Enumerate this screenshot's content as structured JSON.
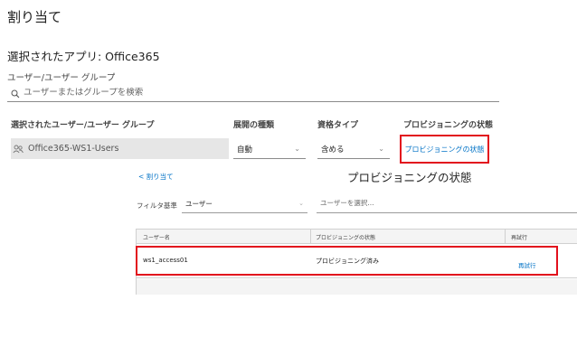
{
  "page": {
    "title": "割り当て"
  },
  "app": {
    "label": "選択されたアプリ: Office365"
  },
  "user_group": {
    "label": "ユーザー/ユーザー グループ",
    "search_placeholder": "ユーザーまたはグループを検索"
  },
  "assignment_table": {
    "headers": {
      "users": "選択されたユーザー/ユーザー グループ",
      "deployment": "展開の種類",
      "entitlement": "資格タイプ",
      "provisioning": "プロビジョニングの状態"
    },
    "row": {
      "user": "Office365-WS1-Users",
      "deployment": "自動",
      "entitlement": "含める",
      "provisioning_link": "プロビジョニングの状態"
    }
  },
  "panel": {
    "back_link": "< 割り当て",
    "title": "プロビジョニングの状態",
    "filter_label": "フィルタ基準",
    "filter_value": "ユーザー",
    "user_input_placeholder": "ユーザーを選択...",
    "table": {
      "headers": {
        "username": "ユーザー名",
        "status": "プロビジョニングの状態",
        "retry": "再試行"
      },
      "rows": [
        {
          "username": "ws1_access01",
          "status": "プロビジョニング済み",
          "retry": "再試行"
        }
      ]
    }
  },
  "colors": {
    "link": "#0072c6",
    "highlight": "#e2101d",
    "cell_bg": "#e6e6e6"
  }
}
